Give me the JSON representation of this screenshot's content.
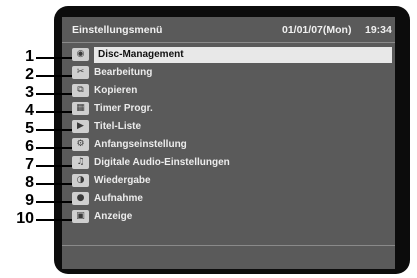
{
  "header": {
    "title": "Einstellungsmenü",
    "date": "01/01/07(Mon)",
    "time": "19:34"
  },
  "menu": {
    "items": [
      {
        "number": "1",
        "label": "Disc-Management",
        "icon": "disc-icon",
        "selected": true
      },
      {
        "number": "2",
        "label": "Bearbeitung",
        "icon": "edit-icon",
        "selected": false
      },
      {
        "number": "3",
        "label": "Kopieren",
        "icon": "copy-icon",
        "selected": false
      },
      {
        "number": "4",
        "label": "Timer Progr.",
        "icon": "timer-icon",
        "selected": false
      },
      {
        "number": "5",
        "label": "Titel-Liste",
        "icon": "title-list-icon",
        "selected": false
      },
      {
        "number": "6",
        "label": "Anfangseinstellung",
        "icon": "initial-setup-icon",
        "selected": false
      },
      {
        "number": "7",
        "label": "Digitale Audio-Einstellungen",
        "icon": "digital-audio-icon",
        "selected": false
      },
      {
        "number": "8",
        "label": "Wiedergabe",
        "icon": "playback-icon",
        "selected": false
      },
      {
        "number": "9",
        "label": "Aufnahme",
        "icon": "record-icon",
        "selected": false
      },
      {
        "number": "10",
        "label": "Anzeige",
        "icon": "display-icon",
        "selected": false
      }
    ]
  }
}
